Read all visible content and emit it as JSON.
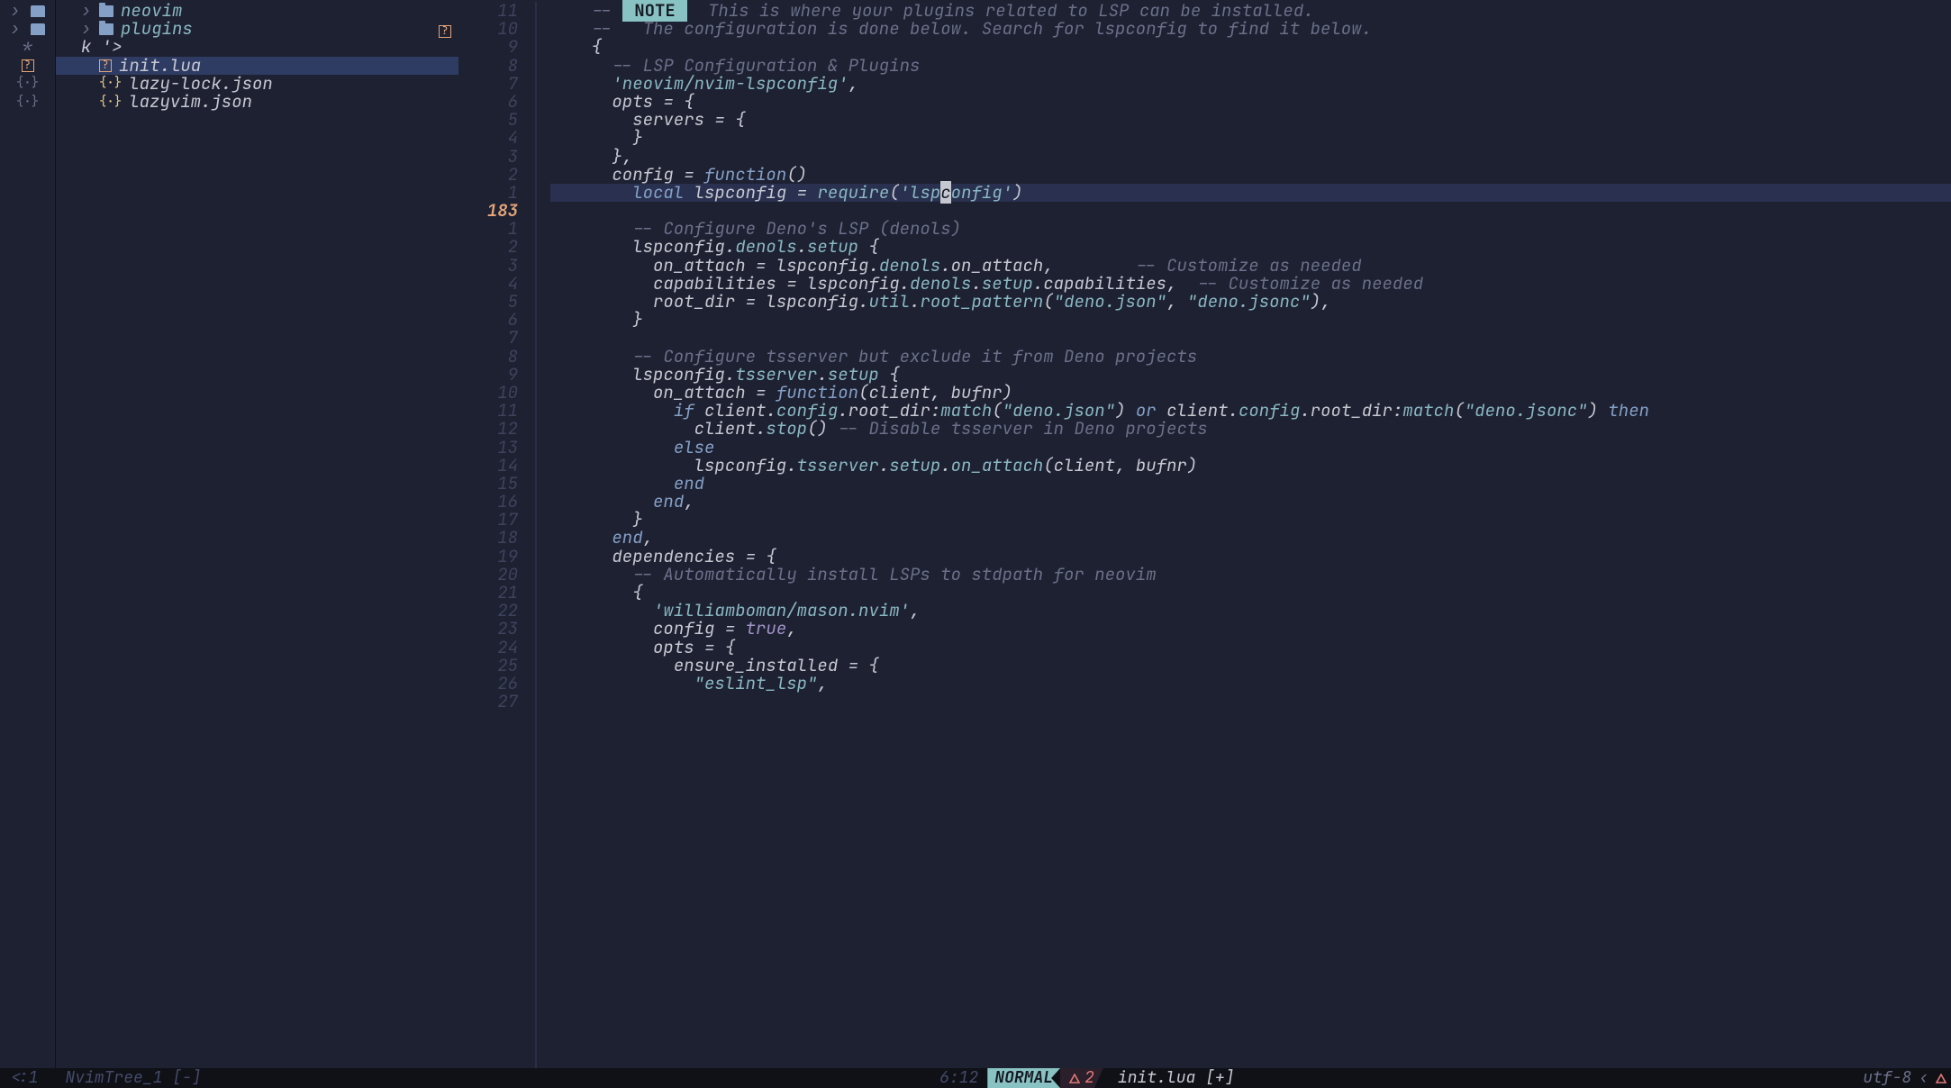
{
  "signs": [
    {
      "type": "chev-folder"
    },
    {
      "type": "chev-folder"
    },
    {
      "type": "star"
    },
    {
      "type": "box"
    },
    {
      "type": "json"
    },
    {
      "type": "json"
    }
  ],
  "tree": [
    {
      "level": 1,
      "type": "folder",
      "label": "neovim",
      "chev": "›"
    },
    {
      "level": 1,
      "type": "folder",
      "label": "plugins",
      "chev": "›",
      "status": "?"
    },
    {
      "level": 1,
      "type": "text",
      "label": "k '>"
    },
    {
      "level": 2,
      "type": "file",
      "label": "init.lua",
      "icon": "box",
      "selected": true
    },
    {
      "level": 2,
      "type": "file",
      "label": "lazy-lock.json",
      "icon": "json"
    },
    {
      "level": 2,
      "type": "file",
      "label": "lazyvim.json",
      "icon": "json"
    }
  ],
  "gutter": [
    "11",
    "10",
    "9",
    "8",
    "7",
    "6",
    "5",
    "4",
    "3",
    "2",
    "1",
    "183",
    "1",
    "2",
    "3",
    "4",
    "5",
    "6",
    "7",
    "8",
    "9",
    "10",
    "11",
    "12",
    "13",
    "14",
    "15",
    "16",
    "17",
    "18",
    "19",
    "20",
    "21",
    "22",
    "23",
    "24",
    "25",
    "26",
    "27"
  ],
  "gutter_current_index": 11,
  "code_lines": [
    {
      "tokens": [
        {
          "t": "    ",
          "c": ""
        },
        {
          "t": "-- ",
          "c": "c"
        },
        {
          "t": " NOTE ",
          "c": "note"
        },
        {
          "t": "  This is where your plugins related to LSP can be installed.",
          "c": "c"
        }
      ]
    },
    {
      "tokens": [
        {
          "t": "    ",
          "c": ""
        },
        {
          "t": "--   The configuration is done below. Search for lspconfig to find it below.",
          "c": "c"
        }
      ]
    },
    {
      "tokens": [
        {
          "t": "    ",
          "c": ""
        },
        {
          "t": "{",
          "c": "i"
        }
      ]
    },
    {
      "tokens": [
        {
          "t": "      ",
          "c": ""
        },
        {
          "t": "-- LSP Configuration & Plugins",
          "c": "c"
        }
      ]
    },
    {
      "tokens": [
        {
          "t": "      ",
          "c": ""
        },
        {
          "t": "'neovim/nvim-lspconfig'",
          "c": "s"
        },
        {
          "t": ",",
          "c": "i"
        }
      ]
    },
    {
      "tokens": [
        {
          "t": "      ",
          "c": ""
        },
        {
          "t": "opts",
          "c": "i"
        },
        {
          "t": " = ",
          "c": "i"
        },
        {
          "t": "{",
          "c": "i"
        }
      ]
    },
    {
      "tokens": [
        {
          "t": "        ",
          "c": ""
        },
        {
          "t": "servers",
          "c": "i"
        },
        {
          "t": " = ",
          "c": "i"
        },
        {
          "t": "{",
          "c": "i"
        }
      ]
    },
    {
      "tokens": [
        {
          "t": "        ",
          "c": ""
        },
        {
          "t": "}",
          "c": "i"
        }
      ]
    },
    {
      "tokens": [
        {
          "t": "      ",
          "c": ""
        },
        {
          "t": "},",
          "c": "i"
        }
      ]
    },
    {
      "tokens": [
        {
          "t": "      ",
          "c": ""
        },
        {
          "t": "config",
          "c": "i"
        },
        {
          "t": " = ",
          "c": "i"
        },
        {
          "t": "function",
          "c": "k"
        },
        {
          "t": "()",
          "c": "i"
        }
      ]
    },
    {
      "cur": true,
      "tokens": [
        {
          "t": "        ",
          "c": ""
        },
        {
          "t": "local",
          "c": "k"
        },
        {
          "t": " lspconfig ",
          "c": "i"
        },
        {
          "t": "=",
          "c": "i"
        },
        {
          "t": " ",
          "c": ""
        },
        {
          "t": "require",
          "c": "o"
        },
        {
          "t": "(",
          "c": "i"
        },
        {
          "t": "'lsp",
          "c": "s"
        },
        {
          "t": "c",
          "c": "cursor"
        },
        {
          "t": "onfig'",
          "c": "s"
        },
        {
          "t": ")",
          "c": "i"
        }
      ]
    },
    {
      "tokens": [
        {
          "t": "",
          "c": ""
        }
      ]
    },
    {
      "tokens": [
        {
          "t": "        ",
          "c": ""
        },
        {
          "t": "-- Configure Deno's LSP (denols)",
          "c": "c"
        }
      ]
    },
    {
      "tokens": [
        {
          "t": "        ",
          "c": ""
        },
        {
          "t": "lspconfig",
          "c": "i"
        },
        {
          "t": ".",
          "c": "i"
        },
        {
          "t": "denols",
          "c": "o"
        },
        {
          "t": ".",
          "c": "i"
        },
        {
          "t": "setup",
          "c": "o"
        },
        {
          "t": " {",
          "c": "i"
        }
      ]
    },
    {
      "tokens": [
        {
          "t": "          ",
          "c": ""
        },
        {
          "t": "on_attach",
          "c": "i"
        },
        {
          "t": " = ",
          "c": "i"
        },
        {
          "t": "lspconfig",
          "c": "i"
        },
        {
          "t": ".",
          "c": "i"
        },
        {
          "t": "denols",
          "c": "o"
        },
        {
          "t": ".",
          "c": "i"
        },
        {
          "t": "on_attach",
          "c": "i"
        },
        {
          "t": ",",
          "c": "i"
        },
        {
          "t": "        ",
          "c": ""
        },
        {
          "t": "-- Customize as needed",
          "c": "c"
        }
      ]
    },
    {
      "tokens": [
        {
          "t": "          ",
          "c": ""
        },
        {
          "t": "capabilities",
          "c": "i"
        },
        {
          "t": " = ",
          "c": "i"
        },
        {
          "t": "lspconfig",
          "c": "i"
        },
        {
          "t": ".",
          "c": "i"
        },
        {
          "t": "denols",
          "c": "o"
        },
        {
          "t": ".",
          "c": "i"
        },
        {
          "t": "setup",
          "c": "o"
        },
        {
          "t": ".",
          "c": "i"
        },
        {
          "t": "capabilities",
          "c": "i"
        },
        {
          "t": ",",
          "c": "i"
        },
        {
          "t": "  ",
          "c": ""
        },
        {
          "t": "-- Customize as needed",
          "c": "c"
        }
      ]
    },
    {
      "tokens": [
        {
          "t": "          ",
          "c": ""
        },
        {
          "t": "root_dir",
          "c": "i"
        },
        {
          "t": " = ",
          "c": "i"
        },
        {
          "t": "lspconfig",
          "c": "i"
        },
        {
          "t": ".",
          "c": "i"
        },
        {
          "t": "util",
          "c": "o"
        },
        {
          "t": ".",
          "c": "i"
        },
        {
          "t": "root_pattern",
          "c": "o"
        },
        {
          "t": "(",
          "c": "i"
        },
        {
          "t": "\"deno.json\"",
          "c": "s"
        },
        {
          "t": ", ",
          "c": "i"
        },
        {
          "t": "\"deno.jsonc\"",
          "c": "s"
        },
        {
          "t": "),",
          "c": "i"
        }
      ]
    },
    {
      "tokens": [
        {
          "t": "        ",
          "c": ""
        },
        {
          "t": "}",
          "c": "i"
        }
      ]
    },
    {
      "tokens": [
        {
          "t": "",
          "c": ""
        }
      ]
    },
    {
      "tokens": [
        {
          "t": "        ",
          "c": ""
        },
        {
          "t": "-- Configure tsserver but exclude it from Deno projects",
          "c": "c"
        }
      ]
    },
    {
      "tokens": [
        {
          "t": "        ",
          "c": ""
        },
        {
          "t": "lspconfig",
          "c": "i"
        },
        {
          "t": ".",
          "c": "i"
        },
        {
          "t": "tsserver",
          "c": "o"
        },
        {
          "t": ".",
          "c": "i"
        },
        {
          "t": "setup",
          "c": "o"
        },
        {
          "t": " {",
          "c": "i"
        }
      ]
    },
    {
      "tokens": [
        {
          "t": "          ",
          "c": ""
        },
        {
          "t": "on_attach",
          "c": "i"
        },
        {
          "t": " = ",
          "c": "i"
        },
        {
          "t": "function",
          "c": "k"
        },
        {
          "t": "(",
          "c": "i"
        },
        {
          "t": "client",
          "c": "i"
        },
        {
          "t": ", ",
          "c": "i"
        },
        {
          "t": "bufnr",
          "c": "i"
        },
        {
          "t": ")",
          "c": "i"
        }
      ]
    },
    {
      "tokens": [
        {
          "t": "            ",
          "c": ""
        },
        {
          "t": "if",
          "c": "k"
        },
        {
          "t": " client",
          "c": "i"
        },
        {
          "t": ".",
          "c": "i"
        },
        {
          "t": "config",
          "c": "o"
        },
        {
          "t": ".",
          "c": "i"
        },
        {
          "t": "root_dir",
          "c": "i"
        },
        {
          "t": ":",
          "c": "i"
        },
        {
          "t": "match",
          "c": "o"
        },
        {
          "t": "(",
          "c": "i"
        },
        {
          "t": "\"deno.json\"",
          "c": "s"
        },
        {
          "t": ") ",
          "c": "i"
        },
        {
          "t": "or",
          "c": "k"
        },
        {
          "t": " client",
          "c": "i"
        },
        {
          "t": ".",
          "c": "i"
        },
        {
          "t": "config",
          "c": "o"
        },
        {
          "t": ".",
          "c": "i"
        },
        {
          "t": "root_dir",
          "c": "i"
        },
        {
          "t": ":",
          "c": "i"
        },
        {
          "t": "match",
          "c": "o"
        },
        {
          "t": "(",
          "c": "i"
        },
        {
          "t": "\"deno.jsonc\"",
          "c": "s"
        },
        {
          "t": ") ",
          "c": "i"
        },
        {
          "t": "then",
          "c": "k"
        }
      ]
    },
    {
      "tokens": [
        {
          "t": "              ",
          "c": ""
        },
        {
          "t": "client",
          "c": "i"
        },
        {
          "t": ".",
          "c": "i"
        },
        {
          "t": "stop",
          "c": "o"
        },
        {
          "t": "()",
          "c": "i"
        },
        {
          "t": " ",
          "c": ""
        },
        {
          "t": "-- Disable tsserver in Deno projects",
          "c": "c"
        }
      ]
    },
    {
      "tokens": [
        {
          "t": "            ",
          "c": ""
        },
        {
          "t": "else",
          "c": "k"
        }
      ]
    },
    {
      "tokens": [
        {
          "t": "              ",
          "c": ""
        },
        {
          "t": "lspconfig",
          "c": "i"
        },
        {
          "t": ".",
          "c": "i"
        },
        {
          "t": "tsserver",
          "c": "o"
        },
        {
          "t": ".",
          "c": "i"
        },
        {
          "t": "setup",
          "c": "o"
        },
        {
          "t": ".",
          "c": "i"
        },
        {
          "t": "on_attach",
          "c": "o"
        },
        {
          "t": "(",
          "c": "i"
        },
        {
          "t": "client",
          "c": "i"
        },
        {
          "t": ", ",
          "c": "i"
        },
        {
          "t": "bufnr",
          "c": "i"
        },
        {
          "t": ")",
          "c": "i"
        }
      ]
    },
    {
      "tokens": [
        {
          "t": "            ",
          "c": ""
        },
        {
          "t": "end",
          "c": "k"
        }
      ]
    },
    {
      "tokens": [
        {
          "t": "          ",
          "c": ""
        },
        {
          "t": "end",
          "c": "k"
        },
        {
          "t": ",",
          "c": "i"
        }
      ]
    },
    {
      "tokens": [
        {
          "t": "        ",
          "c": ""
        },
        {
          "t": "}",
          "c": "i"
        }
      ]
    },
    {
      "tokens": [
        {
          "t": "      ",
          "c": ""
        },
        {
          "t": "end",
          "c": "k"
        },
        {
          "t": ",",
          "c": "i"
        }
      ]
    },
    {
      "tokens": [
        {
          "t": "      ",
          "c": ""
        },
        {
          "t": "dependencies",
          "c": "i"
        },
        {
          "t": " = ",
          "c": "i"
        },
        {
          "t": "{",
          "c": "i"
        }
      ]
    },
    {
      "tokens": [
        {
          "t": "        ",
          "c": ""
        },
        {
          "t": "-- Automatically install LSPs to stdpath for neovim",
          "c": "c"
        }
      ]
    },
    {
      "tokens": [
        {
          "t": "        ",
          "c": ""
        },
        {
          "t": "{",
          "c": "i"
        }
      ]
    },
    {
      "tokens": [
        {
          "t": "          ",
          "c": ""
        },
        {
          "t": "'williamboman/mason.nvim'",
          "c": "s"
        },
        {
          "t": ",",
          "c": "i"
        }
      ]
    },
    {
      "tokens": [
        {
          "t": "          ",
          "c": ""
        },
        {
          "t": "config",
          "c": "i"
        },
        {
          "t": " = ",
          "c": "i"
        },
        {
          "t": "true",
          "c": "b"
        },
        {
          "t": ",",
          "c": "i"
        }
      ]
    },
    {
      "tokens": [
        {
          "t": "          ",
          "c": ""
        },
        {
          "t": "opts",
          "c": "i"
        },
        {
          "t": " = ",
          "c": "i"
        },
        {
          "t": "{",
          "c": "i"
        }
      ]
    },
    {
      "tokens": [
        {
          "t": "            ",
          "c": ""
        },
        {
          "t": "ensure_installed",
          "c": "i"
        },
        {
          "t": " = ",
          "c": "i"
        },
        {
          "t": "{",
          "c": "i"
        }
      ]
    },
    {
      "tokens": [
        {
          "t": "              ",
          "c": ""
        },
        {
          "t": "\"eslint_lsp\"",
          "c": "s"
        },
        {
          "t": ",",
          "c": "i"
        }
      ]
    }
  ],
  "status": {
    "left_prefix": "<:1",
    "tree_title": "NvimTree_1 [-]",
    "tree_loc": "6:12",
    "mode": "NORMAL",
    "diag_count": "2",
    "filename": "init.lua [+]",
    "encoding": "utf-8",
    "sep": "‹"
  },
  "icons": {
    "warn": "⚠"
  }
}
